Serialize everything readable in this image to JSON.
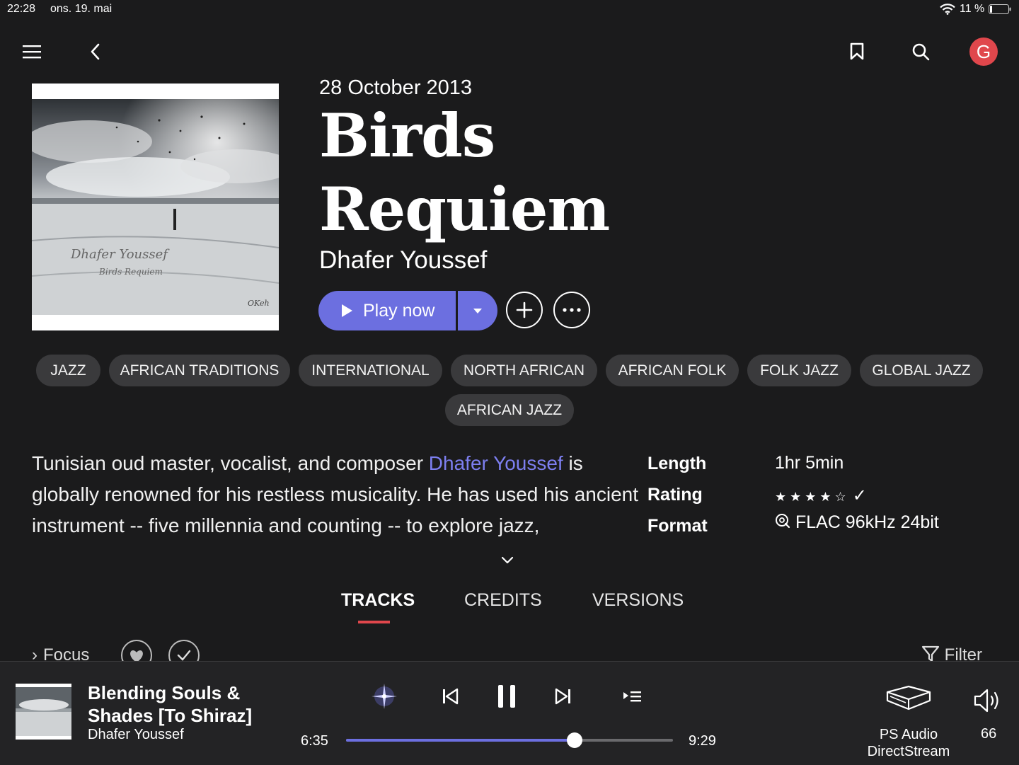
{
  "status_bar": {
    "time": "22:28",
    "date": "ons. 19. mai",
    "battery": "11 %"
  },
  "header": {
    "avatar_letter": "G"
  },
  "album": {
    "release_date": "28 October 2013",
    "title_line1": "Birds",
    "title_line2": "Requiem",
    "artist": "Dhafer Youssef",
    "play_label": "Play now",
    "cover_text_artist": "Dhafer Youssef",
    "cover_text_title": "Birds Requiem",
    "cover_text_label": "OKeh"
  },
  "genres": [
    "JAZZ",
    "AFRICAN TRADITIONS",
    "INTERNATIONAL",
    "NORTH AFRICAN",
    "AFRICAN FOLK",
    "FOLK JAZZ",
    "GLOBAL JAZZ",
    "AFRICAN JAZZ"
  ],
  "description": {
    "pre": "Tunisian oud master, vocalist, and composer ",
    "link": "Dhafer Youssef",
    "post": " is globally renowned for his restless musicality. He has used his ancient instrument -- five millennia and counting -- to explore jazz,"
  },
  "meta": {
    "length_label": "Length",
    "length_value": "1hr 5min",
    "rating_label": "Rating",
    "rating_stars": 4,
    "rating_max": 5,
    "format_label": "Format",
    "format_value": "FLAC 96kHz 24bit"
  },
  "tabs": {
    "tracks": "TRACKS",
    "credits": "CREDITS",
    "versions": "VERSIONS",
    "active": "tracks"
  },
  "list_controls": {
    "focus": "Focus",
    "filter": "Filter"
  },
  "now_playing": {
    "title": "Blending Souls & Shades [To Shiraz]",
    "artist": "Dhafer Youssef",
    "elapsed": "6:35",
    "total": "9:29",
    "progress": 0.7,
    "device_line1": "PS Audio",
    "device_line2": "DirectStream",
    "volume": "66"
  },
  "colors": {
    "accent": "#6c6fe0",
    "tab_underline": "#e0474c",
    "avatar": "#e0474c",
    "background": "#1b1b1c"
  }
}
